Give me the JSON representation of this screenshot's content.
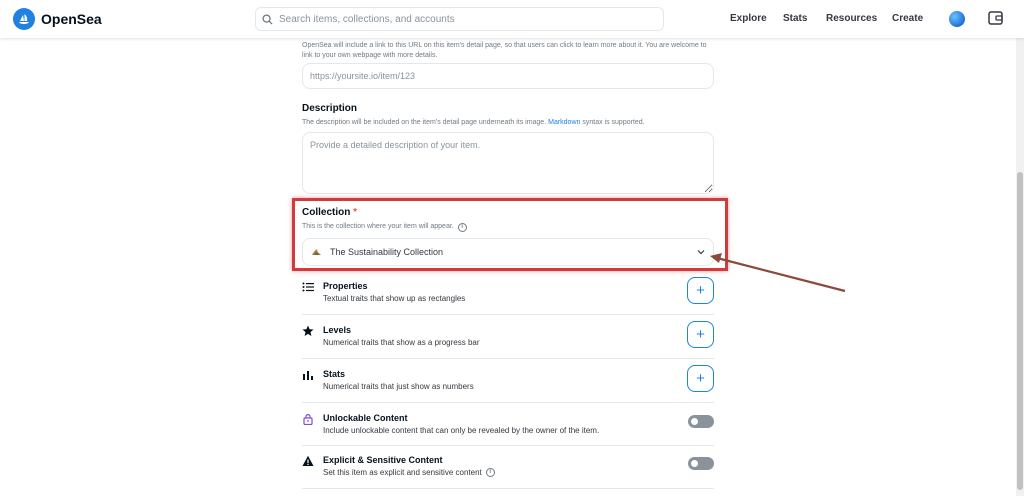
{
  "header": {
    "brand": "OpenSea",
    "search_placeholder": "Search items, collections, and accounts",
    "nav": [
      "Explore",
      "Stats",
      "Resources",
      "Create"
    ]
  },
  "form": {
    "link_hint": "OpenSea will include a link to this URL on this item's detail page, so that users can click to learn more about it. You are welcome to link to your own webpage with more details.",
    "link_placeholder": "https://yoursite.io/item/123",
    "description": {
      "label": "Description",
      "hint_before": "The description will be included on the item's detail page underneath its image.",
      "hint_link": "Markdown",
      "hint_after": "syntax is supported.",
      "placeholder": "Provide a detailed description of your item."
    },
    "collection": {
      "label": "Collection",
      "required_mark": "*",
      "hint": "This is the collection where your item will appear.",
      "info": "i",
      "selected": "The Sustainability Collection"
    },
    "traits": [
      {
        "title": "Properties",
        "desc": "Textual traits that show up as rectangles",
        "icon": "list-icon",
        "action": "+"
      },
      {
        "title": "Levels",
        "desc": "Numerical traits that show as a progress bar",
        "icon": "star-icon",
        "action": "+"
      },
      {
        "title": "Stats",
        "desc": "Numerical traits that just show as numbers",
        "icon": "bar-chart-icon",
        "action": "+"
      }
    ],
    "unlockable": {
      "title": "Unlockable Content",
      "desc": "Include unlockable content that can only be revealed by the owner of the item.",
      "icon": "lock-icon"
    },
    "explicit": {
      "title": "Explicit & Sensitive Content",
      "desc": "Set this item as explicit and sensitive content",
      "icon": "warning-icon",
      "info": "i"
    }
  },
  "colors": {
    "accent": "#2081e2",
    "highlight": "#d23b3b",
    "arrow": "#8b4a3c"
  }
}
